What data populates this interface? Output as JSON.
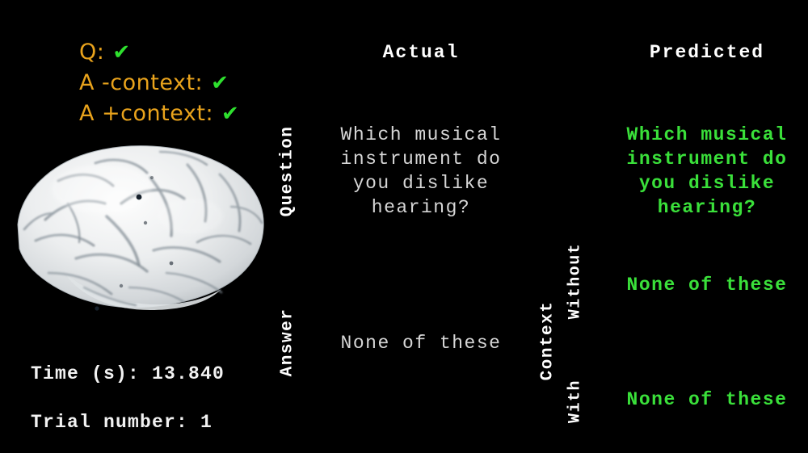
{
  "flags": {
    "items": [
      {
        "label": "Q:",
        "mark": "✔",
        "name": "question-correct"
      },
      {
        "label": "A -context:",
        "mark": "✔",
        "name": "answer-without-context-correct"
      },
      {
        "label": "A +context:",
        "mark": "✔",
        "name": "answer-with-context-correct"
      }
    ],
    "label_color": "#e9a31c",
    "mark_color": "#2ee02e"
  },
  "brain": {
    "caption": "brain-surface-render",
    "surface_color": "#e8e9ea",
    "electrode_color": "#1a2430"
  },
  "readouts": {
    "time": "Time (s): 13.840",
    "trial": "Trial number: 1"
  },
  "headers": {
    "actual": "Actual",
    "predicted": "Predicted"
  },
  "row_labels": {
    "question": "Question",
    "answer": "Answer",
    "context": "Context",
    "without": "Without",
    "with": "With"
  },
  "cells": {
    "actual_question": "Which musical\ninstrument do\nyou dislike\nhearing?",
    "predicted_question": "Which musical\ninstrument do\nyou dislike\nhearing?",
    "actual_answer": "None of these",
    "predicted_answer_without_context": "None of these",
    "predicted_answer_with_context": "None of these"
  },
  "colors": {
    "background": "#000000",
    "actual_text": "#d6d6d6",
    "predicted_text": "#3ae03a",
    "header_text": "#ffffff"
  }
}
